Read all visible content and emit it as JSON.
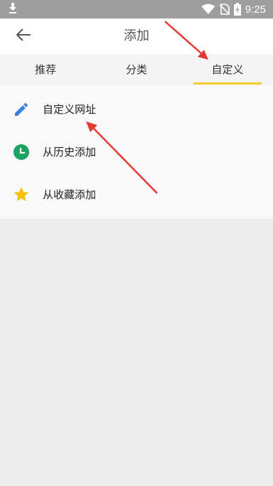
{
  "status_bar": {
    "time": "9:25",
    "icons": [
      "download-icon",
      "wifi-icon",
      "no-sim-icon",
      "battery-charging-icon"
    ]
  },
  "app_bar": {
    "title": "添加",
    "back_icon": "arrow-left-icon"
  },
  "tabs": [
    {
      "label": "推荐",
      "selected": false
    },
    {
      "label": "分类",
      "selected": false
    },
    {
      "label": "自定义",
      "selected": true
    }
  ],
  "list": [
    {
      "label": "自定义网址",
      "icon": "pencil-icon",
      "icon_color": "#3b7ddd"
    },
    {
      "label": "从历史添加",
      "icon": "clock-icon",
      "icon_color": "#1aa260"
    },
    {
      "label": "从收藏添加",
      "icon": "star-icon",
      "icon_color": "#f4c20d"
    }
  ],
  "colors": {
    "accent": "#f2cf2e",
    "annotation_arrow": "#e53935",
    "status_bar": "#9e9e9e",
    "background": "#ececec"
  }
}
